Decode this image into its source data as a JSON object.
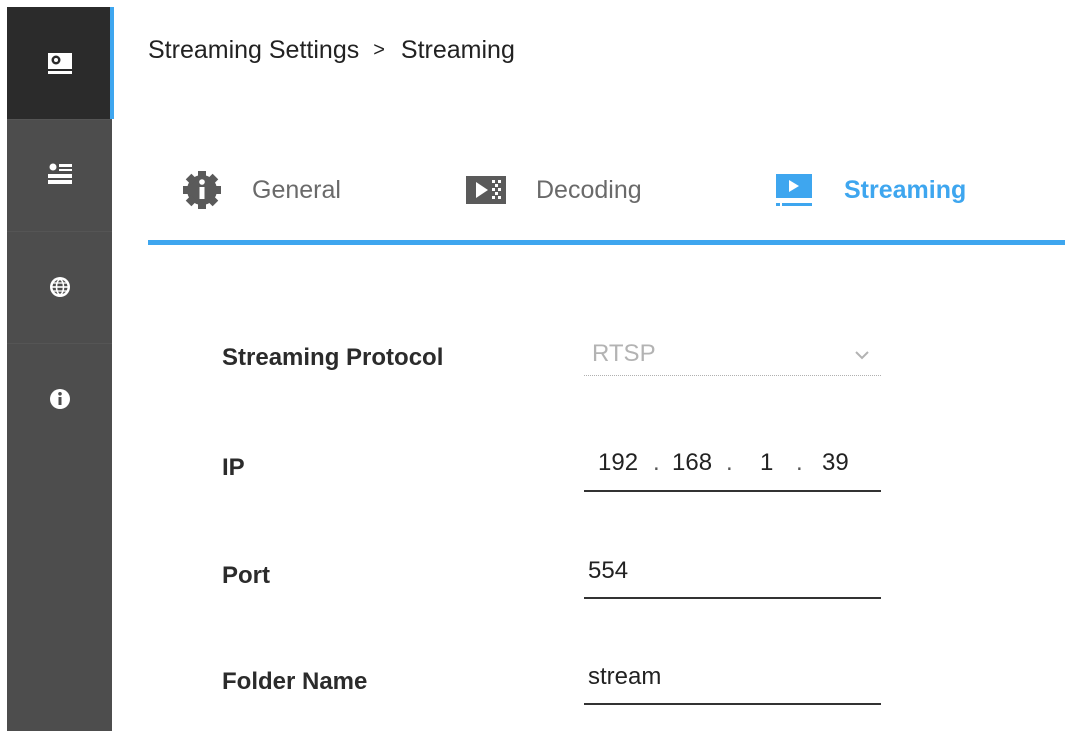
{
  "sidebar": {
    "items": [
      {
        "icon": "device-settings-icon",
        "active": true
      },
      {
        "icon": "server-list-icon",
        "active": false
      },
      {
        "icon": "globe-icon",
        "active": false
      },
      {
        "icon": "info-icon",
        "active": false
      }
    ]
  },
  "breadcrumb": {
    "parent": "Streaming Settings",
    "separator": ">",
    "current": "Streaming"
  },
  "tabs": [
    {
      "label": "General",
      "icon": "info-gear-icon"
    },
    {
      "label": "Decoding",
      "icon": "decoding-icon"
    },
    {
      "label": "Streaming",
      "icon": "streaming-play-icon",
      "active": true
    }
  ],
  "colors": {
    "accent": "#3ea6ef",
    "sidebar": "#4d4d4d",
    "sidebar_active": "#2b2b2b"
  },
  "form": {
    "protocol": {
      "label": "Streaming Protocol",
      "value": "RTSP"
    },
    "ip": {
      "label": "IP",
      "octets": [
        "192",
        "168",
        "1",
        "39"
      ]
    },
    "port": {
      "label": "Port",
      "value": "554"
    },
    "folder": {
      "label": "Folder Name",
      "value": "stream"
    }
  }
}
